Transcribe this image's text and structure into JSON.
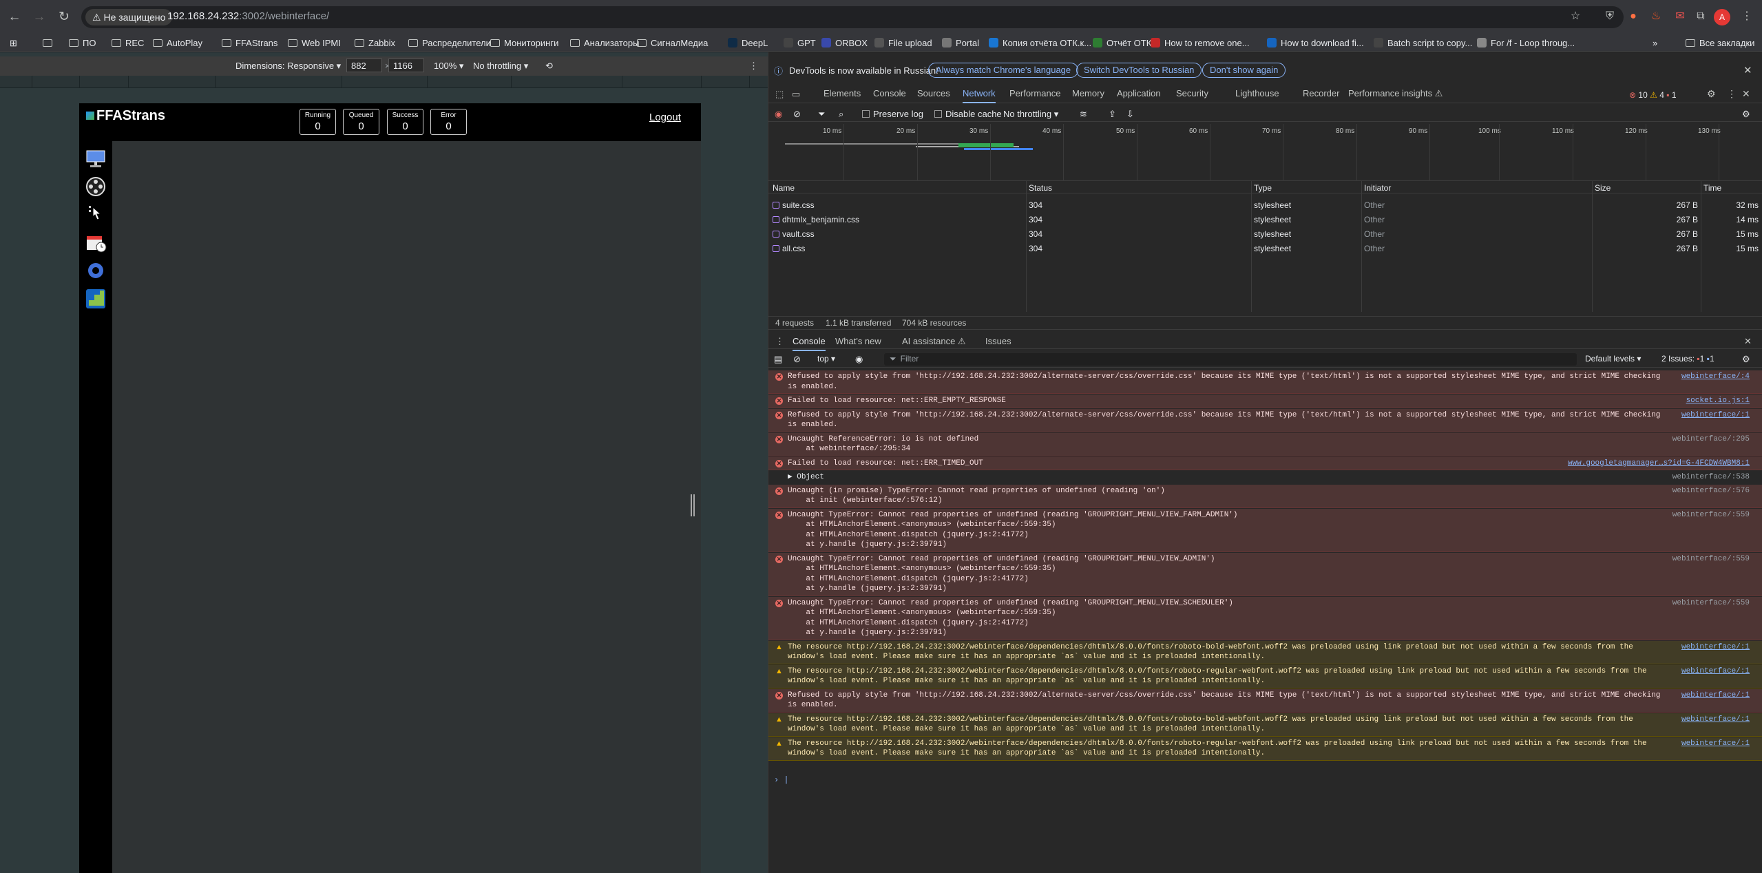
{
  "browser": {
    "security_label": "Не защищено",
    "url_host": "192.168.24.232",
    "url_path": ":3002/webinterface/",
    "profile_initial": "A",
    "bookmarks": [
      "ПО",
      "REC",
      "AutoPlay",
      "FFAStrans",
      "Web IPMI",
      "Zabbix",
      "Распределители",
      "Мониторинги",
      "Анализаторы",
      "СигналМедиа",
      "DeepL",
      "GPT",
      "ORBOX",
      "File upload",
      "Portal",
      "Копия отчёта ОТК.к...",
      "Отчёт ОТК",
      "How to remove one...",
      "How to download fi...",
      "Batch script to copy...",
      "For /f - Loop throug..."
    ],
    "all_bookmarks": "Все закладки"
  },
  "device_toolbar": {
    "dimensions": "Dimensions: Responsive ▾",
    "width": "882",
    "height": "1166",
    "zoom": "100% ▾",
    "throttle": "No throttling ▾"
  },
  "ffa": {
    "logo": "FFAStrans",
    "stats": [
      {
        "label": "Running",
        "value": "0"
      },
      {
        "label": "Queued",
        "value": "0"
      },
      {
        "label": "Success",
        "value": "0"
      },
      {
        "label": "Error",
        "value": "0"
      }
    ],
    "logout": "Logout"
  },
  "devtools": {
    "info": "DevTools is now available in Russian!",
    "btn_match": "Always match Chrome's language",
    "btn_switch": "Switch DevTools to Russian",
    "btn_dont": "Don't show again",
    "tabs": [
      "Elements",
      "Console",
      "Sources",
      "Network",
      "Performance",
      "Memory",
      "Application",
      "Security",
      "Lighthouse",
      "Recorder",
      "Performance insights ⚠"
    ],
    "badges": {
      "errors": "10",
      "warnings": "4",
      "issues": "1"
    },
    "network": {
      "preserve_log": "Preserve log",
      "disable_cache": "Disable cache",
      "throttle": "No throttling ▾",
      "timeline_labels": [
        "10 ms",
        "20 ms",
        "30 ms",
        "40 ms",
        "50 ms",
        "60 ms",
        "70 ms",
        "80 ms",
        "90 ms",
        "100 ms",
        "110 ms",
        "120 ms",
        "130 ms"
      ],
      "columns": [
        "Name",
        "Status",
        "Type",
        "Initiator",
        "Size",
        "Time"
      ],
      "rows": [
        {
          "name": "suite.css",
          "status": "304",
          "type": "stylesheet",
          "initiator": "Other",
          "size": "267 B",
          "time": "32 ms"
        },
        {
          "name": "dhtmlx_benjamin.css",
          "status": "304",
          "type": "stylesheet",
          "initiator": "Other",
          "size": "267 B",
          "time": "14 ms"
        },
        {
          "name": "vault.css",
          "status": "304",
          "type": "stylesheet",
          "initiator": "Other",
          "size": "267 B",
          "time": "15 ms"
        },
        {
          "name": "all.css",
          "status": "304",
          "type": "stylesheet",
          "initiator": "Other",
          "size": "267 B",
          "time": "15 ms"
        }
      ],
      "summary": [
        "4 requests",
        "1.1 kB transferred",
        "704 kB resources"
      ]
    },
    "drawer_tabs": [
      "Console",
      "What's new",
      "AI assistance ⚠",
      "Issues"
    ],
    "console_ctx": "top ▾",
    "filter_placeholder": "Filter",
    "levels": "Default levels ▾",
    "issues_label": "2 Issues:",
    "issues_err": "1",
    "issues_info": "1"
  },
  "console": [
    {
      "kind": "err",
      "src": "webinterface/:4",
      "src_link": true,
      "text": "Refused to apply style from 'http://192.168.24.232:3002/alternate-server/css/override.css' because its MIME type ('text/html') is not a supported stylesheet MIME type, and strict MIME checking\nis enabled."
    },
    {
      "kind": "err",
      "src": "socket.io.js:1",
      "src_link": true,
      "text": "Failed to load resource: net::ERR_EMPTY_RESPONSE"
    },
    {
      "kind": "err",
      "src": "webinterface/:1",
      "src_link": true,
      "text": "Refused to apply style from 'http://192.168.24.232:3002/alternate-server/css/override.css' because its MIME type ('text/html') is not a supported stylesheet MIME type, and strict MIME checking\nis enabled."
    },
    {
      "kind": "err",
      "src": "webinterface/:295",
      "src_link": false,
      "text": "Uncaught ReferenceError: io is not defined\n    at webinterface/:295:34"
    },
    {
      "kind": "err",
      "src": "www.googletagmanager…s?id=G-4FCDW4WBM8:1",
      "src_link": true,
      "text": "Failed to load resource: net::ERR_TIMED_OUT"
    },
    {
      "kind": "plain",
      "src": "webinterface/:538",
      "src_link": false,
      "text": "▶ Object"
    },
    {
      "kind": "err",
      "src": "webinterface/:576",
      "src_link": false,
      "text": "Uncaught (in promise) TypeError: Cannot read properties of undefined (reading 'on')\n    at init (webinterface/:576:12)"
    },
    {
      "kind": "err",
      "src": "webinterface/:559",
      "src_link": false,
      "text": "Uncaught TypeError: Cannot read properties of undefined (reading 'GROUPRIGHT_MENU_VIEW_FARM_ADMIN')\n    at HTMLAnchorElement.<anonymous> (webinterface/:559:35)\n    at HTMLAnchorElement.dispatch (jquery.js:2:41772)\n    at y.handle (jquery.js:2:39791)"
    },
    {
      "kind": "err",
      "src": "webinterface/:559",
      "src_link": false,
      "text": "Uncaught TypeError: Cannot read properties of undefined (reading 'GROUPRIGHT_MENU_VIEW_ADMIN')\n    at HTMLAnchorElement.<anonymous> (webinterface/:559:35)\n    at HTMLAnchorElement.dispatch (jquery.js:2:41772)\n    at y.handle (jquery.js:2:39791)"
    },
    {
      "kind": "err",
      "src": "webinterface/:559",
      "src_link": false,
      "text": "Uncaught TypeError: Cannot read properties of undefined (reading 'GROUPRIGHT_MENU_VIEW_SCHEDULER')\n    at HTMLAnchorElement.<anonymous> (webinterface/:559:35)\n    at HTMLAnchorElement.dispatch (jquery.js:2:41772)\n    at y.handle (jquery.js:2:39791)"
    },
    {
      "kind": "warn",
      "src": "webinterface/:1",
      "src_link": true,
      "text": "The resource http://192.168.24.232:3002/webinterface/dependencies/dhtmlx/8.0.0/fonts/roboto-bold-webfont.woff2 was preloaded using link preload but not used within a few seconds from the\nwindow's load event. Please make sure it has an appropriate `as` value and it is preloaded intentionally."
    },
    {
      "kind": "warn",
      "src": "webinterface/:1",
      "src_link": true,
      "text": "The resource http://192.168.24.232:3002/webinterface/dependencies/dhtmlx/8.0.0/fonts/roboto-regular-webfont.woff2 was preloaded using link preload but not used within a few seconds from the\nwindow's load event. Please make sure it has an appropriate `as` value and it is preloaded intentionally."
    },
    {
      "kind": "err",
      "src": "webinterface/:1",
      "src_link": true,
      "text": "Refused to apply style from 'http://192.168.24.232:3002/alternate-server/css/override.css' because its MIME type ('text/html') is not a supported stylesheet MIME type, and strict MIME checking\nis enabled."
    },
    {
      "kind": "warn",
      "src": "webinterface/:1",
      "src_link": true,
      "text": "The resource http://192.168.24.232:3002/webinterface/dependencies/dhtmlx/8.0.0/fonts/roboto-bold-webfont.woff2 was preloaded using link preload but not used within a few seconds from the\nwindow's load event. Please make sure it has an appropriate `as` value and it is preloaded intentionally."
    },
    {
      "kind": "warn",
      "src": "webinterface/:1",
      "src_link": true,
      "text": "The resource http://192.168.24.232:3002/webinterface/dependencies/dhtmlx/8.0.0/fonts/roboto-regular-webfont.woff2 was preloaded using link preload but not used within a few seconds from the\nwindow's load event. Please make sure it has an appropriate `as` value and it is preloaded intentionally."
    }
  ]
}
